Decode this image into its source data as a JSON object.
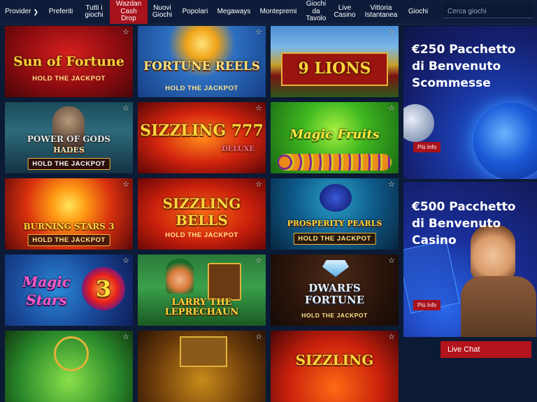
{
  "nav": {
    "items": [
      {
        "label": "Provider",
        "active": false,
        "has_caret": true
      },
      {
        "label": "Preferiti",
        "active": false
      },
      {
        "label": "Tutti i giochi",
        "active": false
      },
      {
        "label": "Wazdan Cash Drop",
        "active": true
      },
      {
        "label": "Nuovi Giochi",
        "active": false
      },
      {
        "label": "Popolari",
        "active": false
      },
      {
        "label": "Megaways",
        "active": false
      },
      {
        "label": "Montepremi",
        "active": false
      },
      {
        "label": "Giochi da Tavolo",
        "active": false
      },
      {
        "label": "Live Casino",
        "active": false
      },
      {
        "label": "Vittoria Istantanea",
        "active": false
      },
      {
        "label": "Giochi",
        "active": false
      }
    ],
    "search_placeholder": "Cerca giochi",
    "caret_icon": "chevron-right-icon"
  },
  "games": [
    {
      "title": "Sun of Fortune",
      "subtitle": "HOLD THE JACKPOT"
    },
    {
      "title": "FORTUNE REELS",
      "subtitle": "HOLD THE JACKPOT"
    },
    {
      "title": "9 LIONS",
      "subtitle": ""
    },
    {
      "title": "POWER OF GODS",
      "title2": "HADES",
      "subtitle": "HOLD THE JACKPOT"
    },
    {
      "title": "SIZZLING 777",
      "title2": "DELUXE",
      "subtitle": ""
    },
    {
      "title": "Magic Fruits",
      "subtitle": ""
    },
    {
      "title": "BURNING STARS 3",
      "subtitle": "HOLD THE JACKPOT"
    },
    {
      "title": "SIZZLING BELLS",
      "subtitle": "HOLD THE JACKPOT"
    },
    {
      "title": "PROSPERITY PEARLS",
      "subtitle": "HOLD THE JACKPOT"
    },
    {
      "title": "Magic Stars",
      "title2": "3",
      "subtitle": ""
    },
    {
      "title": "LARRY THE LEPRECHAUN",
      "subtitle": ""
    },
    {
      "title": "DWARFS FORTUNE",
      "subtitle": "HOLD THE JACKPOT"
    },
    {
      "title": "",
      "subtitle": ""
    },
    {
      "title": "",
      "subtitle": ""
    },
    {
      "title": "SIZZLING",
      "subtitle": ""
    }
  ],
  "favorite_icon": "star-outline-icon",
  "promos": [
    {
      "heading": "€250 Pacchetto di Benvenuto Scommesse",
      "button": "Più Info"
    },
    {
      "heading": "€500 Pacchetto di Benvenuto Casino",
      "button": "Più Info"
    }
  ],
  "live_chat": "Live Chat",
  "colors": {
    "accent": "#a8121b",
    "background": "#0b1a35",
    "nav": "#0e1c3a"
  }
}
